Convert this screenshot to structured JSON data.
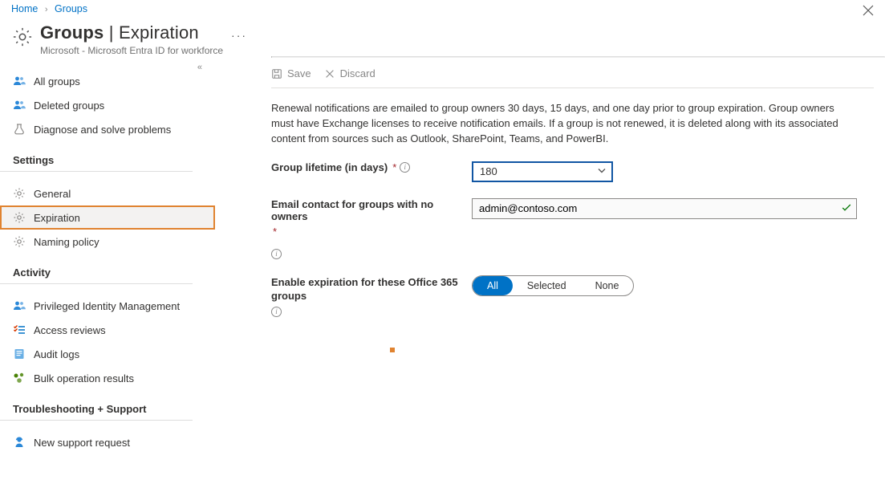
{
  "breadcrumb": {
    "home": "Home",
    "groups": "Groups"
  },
  "header": {
    "title_main": "Groups",
    "title_sep": " | ",
    "title_sub": "Expiration",
    "dots": "···",
    "subtitle": "Microsoft - Microsoft Entra ID for workforce"
  },
  "toolbar": {
    "save": "Save",
    "discard": "Discard"
  },
  "sidebar": {
    "items_main": [
      {
        "label": "All groups"
      },
      {
        "label": "Deleted groups"
      },
      {
        "label": "Diagnose and solve problems"
      }
    ],
    "section_settings": "Settings",
    "items_settings": [
      {
        "label": "General"
      },
      {
        "label": "Expiration"
      },
      {
        "label": "Naming policy"
      }
    ],
    "section_activity": "Activity",
    "items_activity": [
      {
        "label": "Privileged Identity Management"
      },
      {
        "label": "Access reviews"
      },
      {
        "label": "Audit logs"
      },
      {
        "label": "Bulk operation results"
      }
    ],
    "section_trouble": "Troubleshooting + Support",
    "items_trouble": [
      {
        "label": "New support request"
      }
    ]
  },
  "content": {
    "description": "Renewal notifications are emailed to group owners 30 days, 15 days, and one day prior to group expiration. Group owners must have Exchange licenses to receive notification emails. If a group is not renewed, it is deleted along with its associated content from sources such as Outlook, SharePoint, Teams, and PowerBI.",
    "lifetime_label": "Group lifetime (in days)",
    "lifetime_value": "180",
    "email_label": "Email contact for groups with no owners",
    "email_value": "admin@contoso.com",
    "enable_label": "Enable expiration for these Office 365 groups",
    "seg": {
      "all": "All",
      "selected": "Selected",
      "none": "None"
    }
  }
}
